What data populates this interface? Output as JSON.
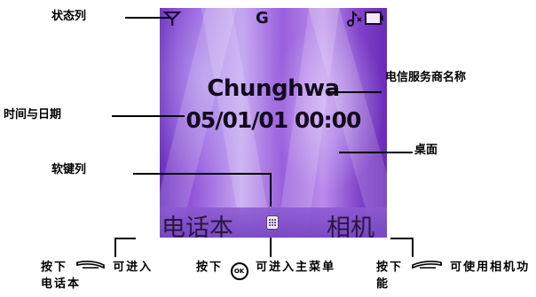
{
  "screen": {
    "status": {
      "signal_icon": "signal-antenna-icon",
      "gprs_letter": "G",
      "ringer_icon": "ringer-icon",
      "battery_icon": "battery-icon"
    },
    "operator": "Chunghwa",
    "datetime": "05/01/01 00:00",
    "softkeys": {
      "left": "电话本",
      "center_icon": "menu-grid-icon",
      "right": "相机"
    }
  },
  "callouts": {
    "status_bar": "状态列",
    "operator_name": "电信服务商名称",
    "time_date": "时间与日期",
    "desktop": "桌面",
    "softkey_row": "软键列"
  },
  "instructions": {
    "left": {
      "pre": "按下",
      "post": "可进入电话本"
    },
    "center": {
      "pre": "按下",
      "post": "可进入主菜单",
      "button_text": "OK"
    },
    "right": {
      "pre": "按下",
      "post": "可使用相机功能"
    }
  }
}
